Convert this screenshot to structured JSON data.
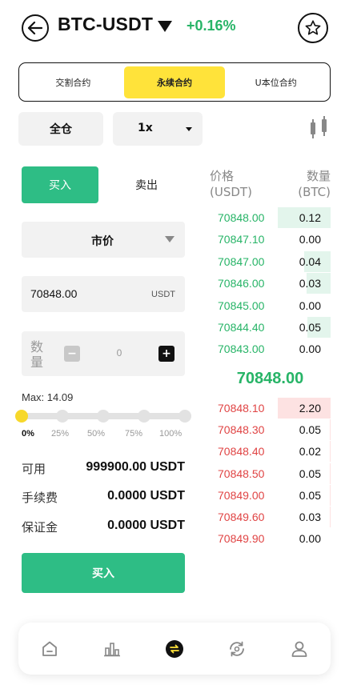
{
  "header": {
    "pair": "BTC-USDT",
    "change": "+0.16%",
    "change_color": "#27b467",
    "back_icon": "arrow-left-icon",
    "favorite_icon": "star-icon"
  },
  "contract_tabs": [
    {
      "label": "交割合约",
      "active": false
    },
    {
      "label": "永续合约",
      "active": true
    },
    {
      "label": "U本位合约",
      "active": false
    }
  ],
  "margin_mode": "全仓",
  "leverage": "1x",
  "trade": {
    "buy_label": "买入",
    "sell_label": "卖出",
    "order_type": "市价",
    "price": "70848.00",
    "price_unit": "USDT",
    "qty_label": "数量",
    "qty_value": "0",
    "max_text": "Max: 14.09",
    "slider_percent": 0,
    "slider_labels": [
      "0%",
      "25%",
      "50%",
      "75%",
      "100%"
    ],
    "info": [
      {
        "label": "可用",
        "value": "999900.00 USDT"
      },
      {
        "label": "手续费",
        "value": "0.0000 USDT"
      },
      {
        "label": "保证金",
        "value": "0.0000 USDT"
      }
    ],
    "submit_label": "买入"
  },
  "order_book": {
    "price_header": "价格",
    "price_unit": "(USDT)",
    "qty_header": "数量",
    "qty_unit": "(BTC)",
    "bids": [
      {
        "price": "70848.00",
        "qty": "0.12",
        "depth": 1.0
      },
      {
        "price": "70847.10",
        "qty": "0.00",
        "depth": 0.0
      },
      {
        "price": "70847.00",
        "qty": "0.04",
        "depth": 0.5
      },
      {
        "price": "70846.00",
        "qty": "0.03",
        "depth": 0.45
      },
      {
        "price": "70845.00",
        "qty": "0.00",
        "depth": 0.0
      },
      {
        "price": "70844.40",
        "qty": "0.05",
        "depth": 0.44
      },
      {
        "price": "70843.00",
        "qty": "0.00",
        "depth": 0.0
      }
    ],
    "last_price": "70848.00",
    "asks": [
      {
        "price": "70848.10",
        "qty": "2.20",
        "depth": 1.0
      },
      {
        "price": "70848.30",
        "qty": "0.05",
        "depth": 0.02
      },
      {
        "price": "70848.40",
        "qty": "0.02",
        "depth": 0.01
      },
      {
        "price": "70848.50",
        "qty": "0.05",
        "depth": 0.02
      },
      {
        "price": "70849.00",
        "qty": "0.05",
        "depth": 0.02
      },
      {
        "price": "70849.60",
        "qty": "0.03",
        "depth": 0.01
      },
      {
        "price": "70849.90",
        "qty": "0.00",
        "depth": 0.0
      }
    ]
  },
  "bottom_nav": [
    {
      "icon": "home-icon"
    },
    {
      "icon": "market-chart-icon"
    },
    {
      "icon": "trade-exchange-icon",
      "active": true
    },
    {
      "icon": "contract-refresh-icon"
    },
    {
      "icon": "user-profile-icon"
    }
  ],
  "colors": {
    "buy_green": "#2ebd85",
    "sell_red": "#e04444",
    "accent_yellow": "#ffe33a"
  }
}
